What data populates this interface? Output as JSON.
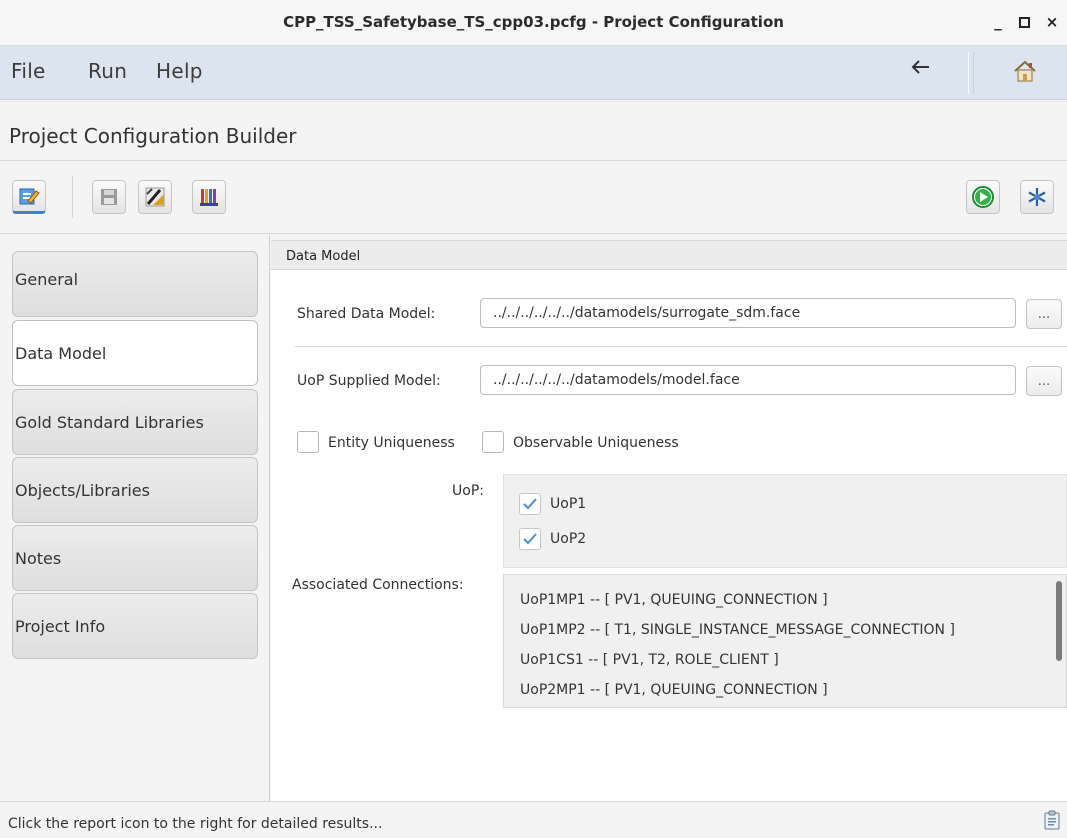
{
  "window": {
    "title": "CPP_TSS_Safetybase_TS_cpp03.pcfg - Project Configuration",
    "minimize": "_",
    "maximize": "□",
    "close": "×"
  },
  "menu": {
    "items": [
      "File",
      "Run",
      "Help"
    ],
    "back_icon": "back-arrow-icon",
    "home_icon": "home-icon"
  },
  "header": {
    "title": "Project Configuration Builder"
  },
  "toolbar": {
    "left_icons": [
      "edit-icon",
      "save-icon",
      "clear-icon",
      "library-icon"
    ],
    "right_icons": [
      "run-icon",
      "snowflake-icon"
    ]
  },
  "sidebar": {
    "tabs": [
      "General",
      "Data Model",
      "Gold Standard Libraries",
      "Objects/Libraries",
      "Notes",
      "Project Info"
    ],
    "selected": "Data Model"
  },
  "content": {
    "section_title": "Data Model",
    "shared_label": "Shared Data Model:",
    "shared_value": "../../../../../../datamodels/surrogate_sdm.face",
    "uop_model_label": "UoP Supplied Model:",
    "uop_model_value": "../../../../../../datamodels/model.face",
    "browse_label": "...",
    "entity_uniqueness": "Entity Uniqueness",
    "observable_uniqueness": "Observable Uniqueness",
    "uop_label": "UoP:",
    "uops": [
      {
        "label": "UoP1",
        "checked": true
      },
      {
        "label": "UoP2",
        "checked": true
      }
    ],
    "connections_label": "Associated Connections:",
    "connections": [
      "UoP1MP1 -- [ PV1, QUEUING_CONNECTION ]",
      "UoP1MP2 -- [ T1, SINGLE_INSTANCE_MESSAGE_CONNECTION ]",
      "UoP1CS1 -- [ PV1, T2, ROLE_CLIENT ]",
      "UoP2MP1 -- [ PV1, QUEUING_CONNECTION ]"
    ]
  },
  "status": {
    "text": "Click the report icon to the right for detailed results...",
    "report_icon": "report-icon"
  },
  "colors": {
    "menubar_bg": "#dce4f0",
    "accent_blue": "#3a83c9",
    "run_green": "#2fb24a",
    "checkmark": "#4a8fd4"
  }
}
